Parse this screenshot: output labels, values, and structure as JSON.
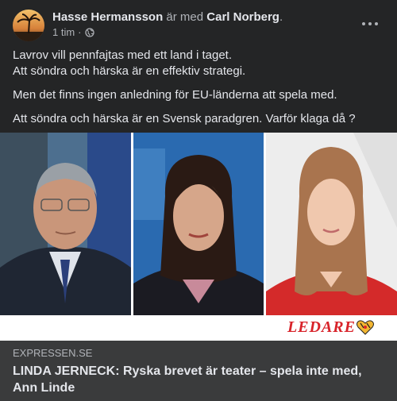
{
  "post": {
    "author": "Hasse Hermansson",
    "with_text": "är med",
    "tagged": "Carl Norberg",
    "tagged_suffix": ".",
    "timestamp": "1 tim",
    "dot": "·",
    "privacy_icon": "globe-icon",
    "more_icon": "more-options-icon",
    "text": {
      "line1": "Lavrov vill pennfajtas med ett land i taget.",
      "line2": "Att söndra och härska är en effektiv strategi.",
      "line3": "Men det finns ingen anledning för EU-länderna att spela med.",
      "line4": "Att söndra och härska är en Svensk paradgren. Varför klaga då ?"
    }
  },
  "link_preview": {
    "badge": "LEDARE",
    "badge_icon": "ledare-heart-icon",
    "domain": "EXPRESSEN.SE",
    "title": "LINDA JERNECK: Ryska brevet är teater – spela inte med, Ann Linde"
  },
  "colors": {
    "background": "#242526",
    "footer_bg": "#3a3b3c",
    "text_primary": "#e4e6eb",
    "text_secondary": "#b0b3b8",
    "ledare_red": "#d8232a"
  }
}
